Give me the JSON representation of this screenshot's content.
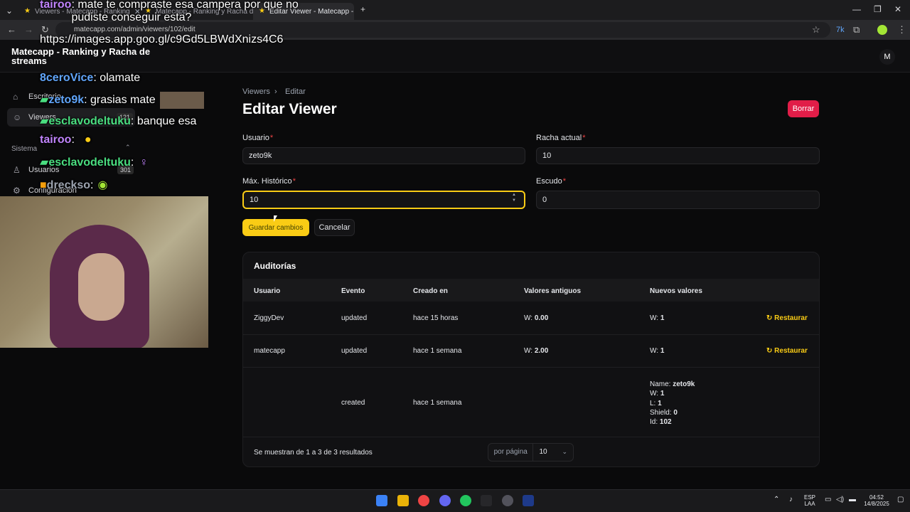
{
  "browser": {
    "tabs": [
      {
        "label": "Viewers - Matecapp - Ranking"
      },
      {
        "label": "Matecapp - Ranking y Racha d"
      },
      {
        "label": "Editar Viewer - Matecapp - Ran"
      }
    ],
    "url": "matecapp.com/admin/viewers/102/edit"
  },
  "app": {
    "brand": "Matecapp - Ranking y Racha de streams",
    "avatar_letter": "M"
  },
  "sidebar": {
    "items": [
      {
        "label": "Escritorio",
        "icon": "home-icon"
      },
      {
        "label": "Viewers",
        "icon": "users-icon",
        "badge": "121"
      },
      {
        "label": "Usuarios",
        "icon": "user-icon"
      },
      {
        "label": "Configuración",
        "icon": "gear-icon"
      }
    ],
    "group_label": "Sistema"
  },
  "chat_overlay": [
    {
      "user": "tairoo",
      "text": ": mate te compraste esa campera por que no pudiste conseguir esta?",
      "color": "#c084fc"
    },
    {
      "user": "",
      "text": "https://images.app.goo.gl/c9Gd5LBWdXnizs4C6",
      "color": "#ffffff"
    },
    {
      "user": "8ceroVice",
      "text": ": olamate",
      "color": "#60a5fa"
    },
    {
      "user": "zeto9k",
      "text": ": grasias mate",
      "color": "#60a5fa"
    },
    {
      "user": "esclavodeltuku",
      "text": ": banque esa",
      "color": "#4ade80"
    },
    {
      "user": "tairoo",
      "text": ":",
      "color": "#c084fc"
    },
    {
      "user": "esclavodeltuku",
      "text": ":",
      "color": "#4ade80"
    },
    {
      "user": "dreckso",
      "text": ":",
      "color": "#9ca3af"
    }
  ],
  "chat_badge": "301",
  "breadcrumb": {
    "root": "Viewers",
    "current": "Editar"
  },
  "page_title": "Editar Viewer",
  "delete_label": "Borrar",
  "form": {
    "usuario_label": "Usuario",
    "usuario_value": "zeto9k",
    "racha_label": "Racha actual",
    "racha_value": "10",
    "max_label": "Máx. Histórico",
    "max_value": "10",
    "escudo_label": "Escudo",
    "escudo_value": "0",
    "save_label": "Guardar cambios",
    "cancel_label": "Cancelar"
  },
  "audits": {
    "title": "Auditorías",
    "columns": [
      "Usuario",
      "Evento",
      "Creado en",
      "Valores antiguos",
      "Nuevos valores"
    ],
    "rows": [
      {
        "usuario": "ZiggyDev",
        "evento": "updated",
        "creado": "hace 15 horas",
        "old_key": "W:",
        "old_val": "0.00",
        "new_key": "W:",
        "new_val": "1",
        "restore": "Restaurar"
      },
      {
        "usuario": "matecapp",
        "evento": "updated",
        "creado": "hace 1 semana",
        "old_key": "W:",
        "old_val": "2.00",
        "new_key": "W:",
        "new_val": "1",
        "restore": "Restaurar"
      },
      {
        "usuario": "",
        "evento": "created",
        "creado": "hace 1 semana",
        "new_lines": [
          {
            "k": "Name:",
            "v": "zeto9k"
          },
          {
            "k": "W:",
            "v": "1"
          },
          {
            "k": "L:",
            "v": "1"
          },
          {
            "k": "Shield:",
            "v": "0"
          },
          {
            "k": "Id:",
            "v": "102"
          }
        ]
      }
    ],
    "showing": "Se muestran de 1 a 3 de 3 resultados",
    "per_page_label": "por página",
    "per_page_value": "10"
  },
  "taskbar": {
    "lang": "ESP",
    "lang2": "LAA",
    "time": "04:52",
    "date": "14/8/2025"
  },
  "colors": {
    "accent": "#facc15",
    "danger": "#e11d48"
  }
}
